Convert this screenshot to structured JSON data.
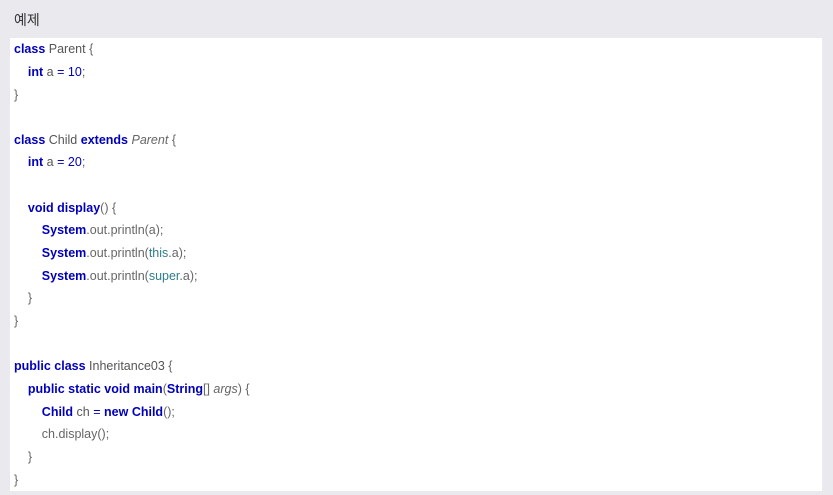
{
  "heading": "예제",
  "code": {
    "l1": {
      "kw": "class",
      "name": "Parent",
      "brace": "{"
    },
    "l2": {
      "kw": "int",
      "var": "a",
      "op": "=",
      "num": "10",
      "semi": ";"
    },
    "l3": {
      "brace": "}"
    },
    "l5": {
      "kw": "class",
      "name": "Child",
      "kw2": "extends",
      "parent": "Parent",
      "brace": "{"
    },
    "l6": {
      "kw": "int",
      "var": "a",
      "op": "=",
      "num": "20",
      "semi": ";"
    },
    "l8": {
      "kw": "void",
      "fn": "display",
      "rest": "() {"
    },
    "l9": {
      "cls": "System",
      "rest": ".out.println(a);"
    },
    "l10": {
      "cls": "System",
      "rest1": ".out.println(",
      "kw": "this",
      "rest2": ".a);"
    },
    "l11": {
      "cls": "System",
      "rest1": ".out.println(",
      "kw": "super",
      "rest2": ".a);"
    },
    "l12": {
      "brace": "}"
    },
    "l13": {
      "brace": "}"
    },
    "l15": {
      "kw": "public class",
      "name": "Inheritance03",
      "brace": "{"
    },
    "l16": {
      "kw": "public static void",
      "fn": "main",
      "p1": "(",
      "ty": "String",
      "arr": "[]",
      "arg": "args",
      "p2": ") {"
    },
    "l17": {
      "ty": "Child",
      "var": "ch",
      "op": "=",
      "kw": "new",
      "ty2": "Child",
      "rest": "();"
    },
    "l18": {
      "text": "ch.display();"
    },
    "l19": {
      "brace": "}"
    },
    "l20": {
      "brace": "}"
    }
  }
}
